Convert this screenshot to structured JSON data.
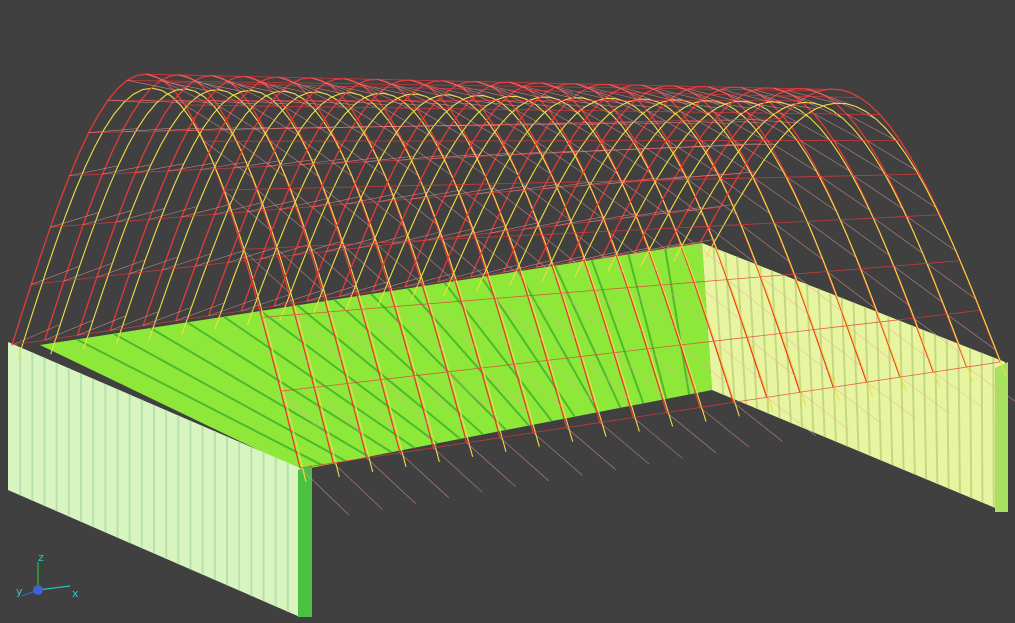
{
  "viewport": {
    "background_color": "#404040"
  },
  "model": {
    "arch_primary_color": "#e8383a",
    "arch_secondary_color": "#f0e040",
    "brace_color": "#f4a0a0",
    "back_wall_color": "#8ee83a",
    "side_wall_color": "#d8f5c0",
    "right_wall_color": "#e8f5a0",
    "edge_color": "#4cba2c"
  },
  "axis_triad": {
    "x_label": "x",
    "y_label": "y",
    "z_label": "z",
    "x_color": "#20c0c0",
    "y_color": "#4060d8",
    "z_color": "#20c040",
    "label_color": "#30c8c8"
  }
}
